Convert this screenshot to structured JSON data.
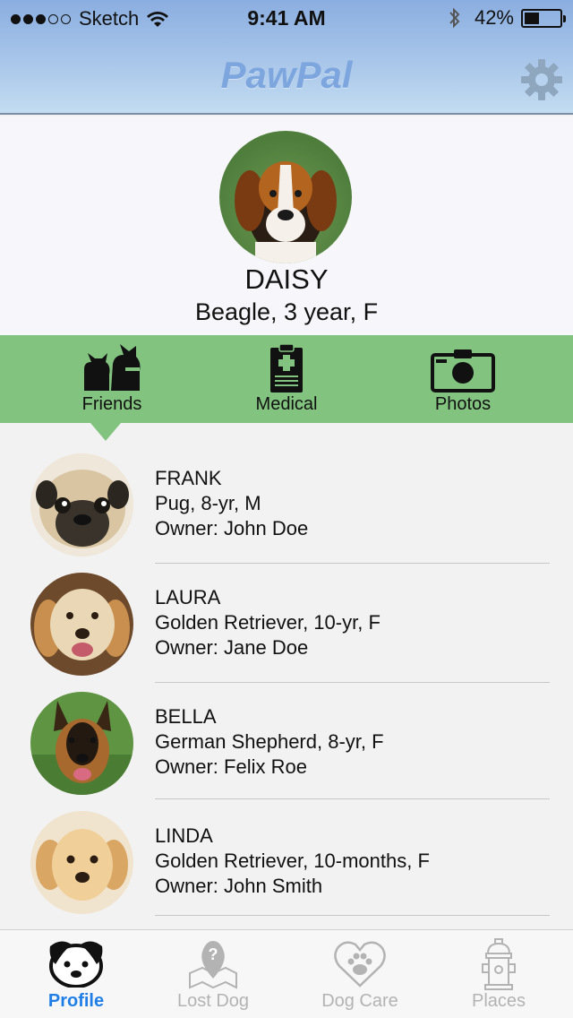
{
  "status_bar": {
    "carrier": "Sketch",
    "time": "9:41 AM",
    "battery": "42%",
    "battery_level": 0.42
  },
  "header": {
    "title": "PawPal",
    "settings_icon": "gear-icon",
    "title_color": "#7ea6de"
  },
  "profile": {
    "name": "DAISY",
    "details": "Beagle, 3 year, F"
  },
  "segments": [
    {
      "label": "Friends",
      "icon": "friends-icon",
      "selected": true
    },
    {
      "label": "Medical",
      "icon": "clipboard-icon",
      "selected": false
    },
    {
      "label": "Photos",
      "icon": "camera-icon",
      "selected": false
    }
  ],
  "friends": [
    {
      "name": "FRANK",
      "details": "Pug, 8-yr, M",
      "owner": "Owner: John Doe"
    },
    {
      "name": "LAURA",
      "details": "Golden Retriever, 10-yr, F",
      "owner": "Owner: Jane Doe"
    },
    {
      "name": "BELLA",
      "details": "German Shepherd, 8-yr, F",
      "owner": "Owner: Felix Roe"
    },
    {
      "name": "LINDA",
      "details": "Golden Retriever, 10-months, F",
      "owner": "Owner: John Smith"
    }
  ],
  "bottom_nav": [
    {
      "label": "Profile",
      "icon": "dog-face-icon",
      "active": true
    },
    {
      "label": "Lost Dog",
      "icon": "map-question-icon",
      "active": false
    },
    {
      "label": "Dog Care",
      "icon": "heart-paw-icon",
      "active": false
    },
    {
      "label": "Places",
      "icon": "fire-hydrant-icon",
      "active": false
    }
  ],
  "colors": {
    "accent_green": "#82c47f",
    "active_blue": "#1f7fe6",
    "inactive_gray": "#b3b3b3"
  }
}
